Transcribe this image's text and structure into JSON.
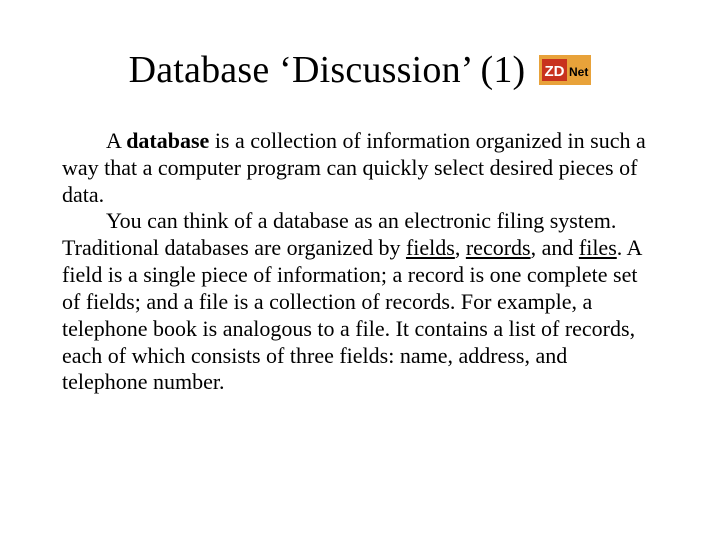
{
  "title": "Database ‘Discussion’ (1)",
  "logo": {
    "name": "zdnet-logo",
    "text_primary": "ZD",
    "text_secondary": "Net",
    "bg": "#e8a23a",
    "accent": "#c8321e",
    "text_color_primary": "#ffffff",
    "text_color_secondary": "#000000"
  },
  "body": {
    "p1_a": "A ",
    "p1_db": "database",
    "p1_b": " is a collection of information organized in such a way that a computer program can quickly select desired pieces of data.",
    "p2_a": "You can think of a database as an electronic filing system. Traditional databases are organized by ",
    "p2_u1": "fields",
    "p2_s1": ", ",
    "p2_u2": "records",
    "p2_s2": ", and ",
    "p2_u3": "files",
    "p2_b": ". A field is a single piece of information; a record is one complete set of fields; and a file is a collection of records. For example, a telephone book is analogous to a file. It contains a list of records, each of which consists of three fields: name, address, and telephone number."
  }
}
